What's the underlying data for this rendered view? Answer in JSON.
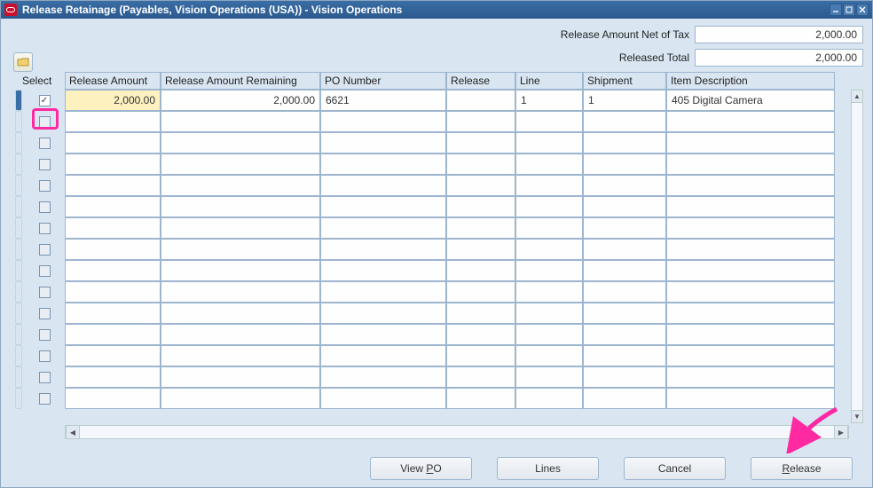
{
  "window": {
    "title": "Release Retainage (Payables, Vision Operations (USA)) - Vision Operations"
  },
  "summary": {
    "net_of_tax_label": "Release Amount Net of Tax",
    "net_of_tax_value": "2,000.00",
    "released_total_label": "Released Total",
    "released_total_value": "2,000.00"
  },
  "grid": {
    "select_header": "Select",
    "columns": {
      "rel_amt": "Release Amount",
      "rel_rem": "Release Amount Remaining",
      "po": "PO Number",
      "release": "Release",
      "line": "Line",
      "shipment": "Shipment",
      "desc": "Item Description"
    },
    "rows": [
      {
        "selected": true,
        "rel_amt": "2,000.00",
        "rel_rem": "2,000.00",
        "po": "6621",
        "release": "",
        "line": "1",
        "shipment": "1",
        "desc": "405 Digital Camera"
      }
    ],
    "empty_row_count": 14
  },
  "buttons": {
    "view_po": "View PO",
    "lines": "Lines",
    "cancel": "Cancel",
    "release": "Release"
  }
}
